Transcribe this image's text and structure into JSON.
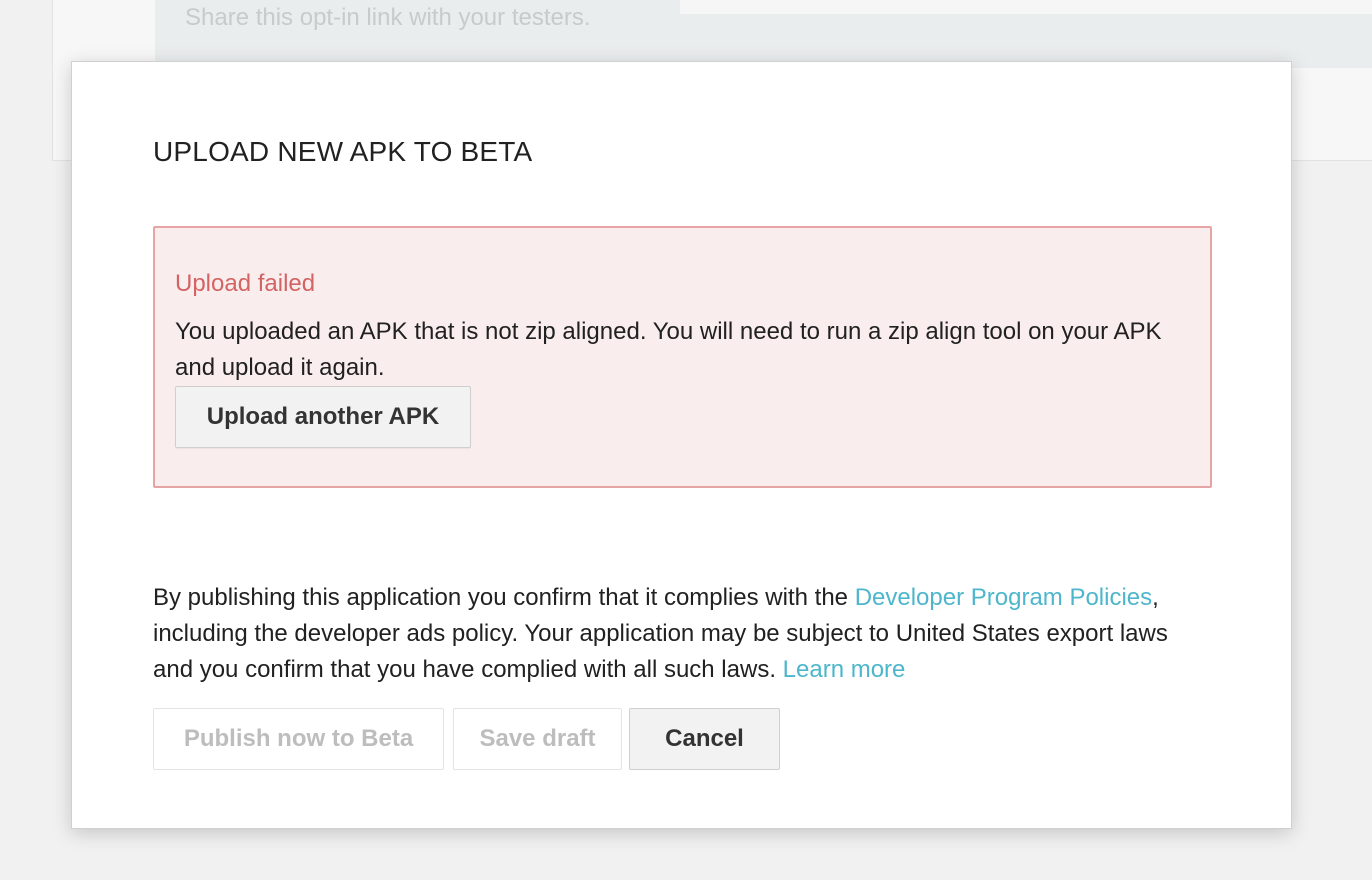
{
  "background": {
    "helper_text": "Share this opt-in link with your testers."
  },
  "modal": {
    "title": "UPLOAD NEW APK TO BETA",
    "error": {
      "title": "Upload failed",
      "message": "You uploaded an APK that is not zip aligned. You will need to run a zip align tool on your APK and upload it again.",
      "button_label": "Upload another APK"
    },
    "legal": {
      "text_before_link": "By publishing this application you confirm that it complies with the ",
      "policy_link": "Developer Program Policies",
      "text_middle": ", including the developer ads policy. Your application may be subject to United States export laws and you confirm that you have complied with all such laws. ",
      "learn_more_link": "Learn more"
    },
    "actions": {
      "publish_label": "Publish now to Beta",
      "save_draft_label": "Save draft",
      "cancel_label": "Cancel"
    }
  },
  "colors": {
    "error_border": "#e5a5a5",
    "error_background": "#f9eeed",
    "error_title": "#d36464",
    "link": "#4eb6cc",
    "disabled_text": "#bdbdbd"
  }
}
